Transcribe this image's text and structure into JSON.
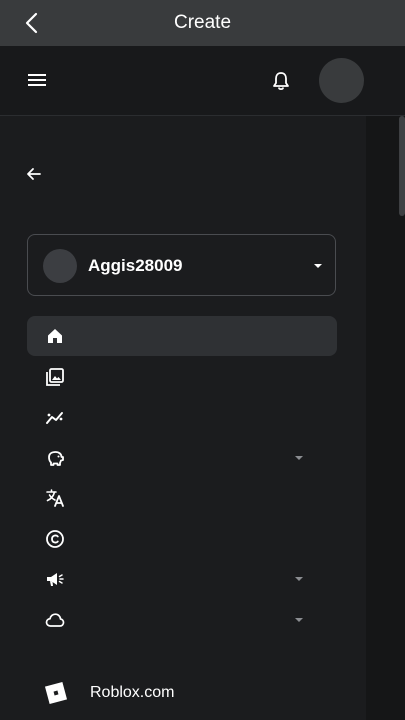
{
  "titlebar": {
    "title": "Create",
    "back_icon": "chevron-left-icon"
  },
  "header": {
    "menu_icon": "hamburger-icon",
    "notifications_icon": "bell-icon",
    "avatar": "avatar"
  },
  "sidebar": {
    "back_icon": "arrow-left-icon",
    "account": {
      "username": "Aggis28009",
      "dropdown_icon": "caret-down-icon"
    },
    "items": [
      {
        "icon": "home-icon",
        "active": true,
        "expandable": false
      },
      {
        "icon": "gallery-icon",
        "active": false,
        "expandable": false
      },
      {
        "icon": "analytics-icon",
        "active": false,
        "expandable": false
      },
      {
        "icon": "piggy-bank-icon",
        "active": false,
        "expandable": true
      },
      {
        "icon": "translate-icon",
        "active": false,
        "expandable": false
      },
      {
        "icon": "copyright-icon",
        "active": false,
        "expandable": false
      },
      {
        "icon": "megaphone-icon",
        "active": false,
        "expandable": true
      },
      {
        "icon": "cloud-icon",
        "active": false,
        "expandable": true
      }
    ],
    "footer_link": {
      "label": "Roblox.com",
      "icon": "roblox-logo-icon"
    }
  },
  "colors": {
    "titlebar": "#393b3d",
    "background": "#121314",
    "sidebar": "#1b1c1e",
    "active_item": "#2f3134",
    "text": "#ffffff"
  }
}
